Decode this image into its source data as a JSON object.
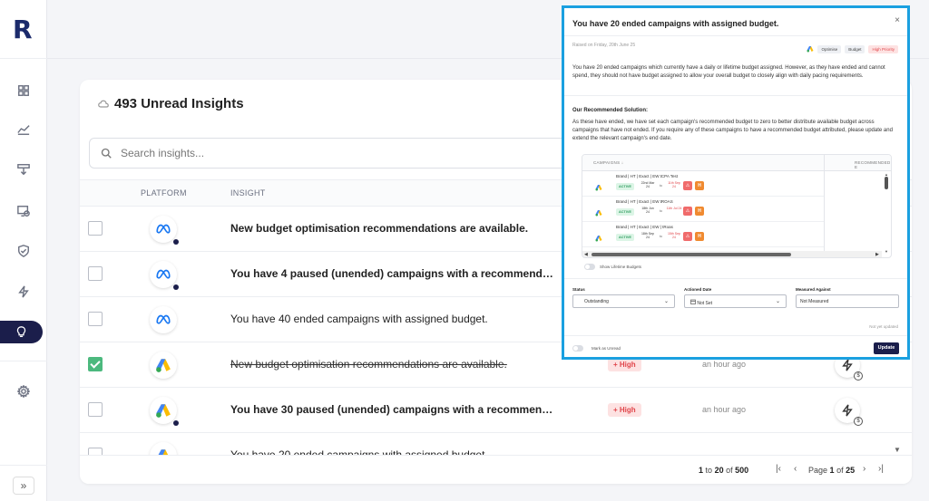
{
  "sidebar": {
    "logo": "R",
    "items": [
      {
        "name": "dashboard",
        "icon": "grid-icon"
      },
      {
        "name": "analytics",
        "icon": "chart-line-icon"
      },
      {
        "name": "budget",
        "icon": "download-table-icon"
      },
      {
        "name": "history",
        "icon": "monitor-clock-icon"
      },
      {
        "name": "security",
        "icon": "shield-icon"
      },
      {
        "name": "automation",
        "icon": "bolt-icon"
      },
      {
        "name": "insights",
        "icon": "lightbulb-icon",
        "active": true
      },
      {
        "name": "settings",
        "icon": "gear-icon"
      }
    ],
    "expand_label": "»"
  },
  "card": {
    "title": "493 Unread Insights",
    "search_placeholder": "Search insights...",
    "columns": {
      "platform": "PLATFORM",
      "insight": "INSIGHT"
    },
    "rows": [
      {
        "platform": "meta",
        "insight": "New budget optimisation recommendations are available.",
        "bold": true,
        "checked": false,
        "unread_dot": true
      },
      {
        "platform": "meta",
        "insight": "You have 4 paused (unended) campaigns with a recommended...",
        "bold": true,
        "checked": false,
        "unread_dot": true
      },
      {
        "platform": "meta",
        "insight": "You have 40 ended campaigns with assigned budget.",
        "bold": false,
        "checked": false,
        "unread_dot": false
      },
      {
        "platform": "google-ads",
        "insight": "New budget optimisation recommendations are available.",
        "bold": false,
        "checked": true,
        "strike": true,
        "unread_dot": false,
        "priority": "+ High",
        "time": "an hour ago"
      },
      {
        "platform": "google-ads",
        "insight": "You have 30 paused (unended) campaigns with a recommende...",
        "bold": true,
        "checked": false,
        "unread_dot": true,
        "priority": "+ High",
        "time": "an hour ago"
      },
      {
        "platform": "google-ads",
        "insight": "You have 20 ended campaigns with assigned budget.",
        "bold": false,
        "checked": false,
        "unread_dot": false,
        "priority": "",
        "time": ""
      }
    ],
    "pagination": {
      "range_start": "1",
      "range_to": "to",
      "range_end": "20",
      "of": "of",
      "total": "500",
      "page_label": "Page",
      "page": "1",
      "page_of": "of",
      "pages": "25"
    }
  },
  "modal": {
    "title": "You have 20 ended campaigns with assigned budget.",
    "raised_on": "Raised on Friday, 20th June 25",
    "tags": [
      "Optimise",
      "Budget",
      "High Priority"
    ],
    "description": "You have 20 ended campaigns which currently have a daily or lifetime budget assigned. However, as they have ended and cannot spend, they should not have budget assigned to allow your overall budget to closely align with daily pacing requirements.",
    "solution_title": "Our Recommended Solution:",
    "solution": "As these have ended, we have set each campaign's recommended budget to zero to better distribute available budget across campaigns that have not ended. If you require any of these campaigns to have a recommended budget attributed, please update and extend the relevant campaign's end date.",
    "table": {
      "col_campaigns": "CAMPAIGNS ↓",
      "col_recommended": "RECOMMENDED E",
      "rows": [
        {
          "name": "Brand | HT | Exact | EW tCPA Test",
          "status": "ACTIVE",
          "start": "22nd Mar 24",
          "to": "to",
          "end": "11th Sep 24",
          "badge": "H"
        },
        {
          "name": "Brand | HT | Exact | EW tROAS",
          "status": "ACTIVE",
          "start": "18th Jun 24",
          "to": "to",
          "end": "11th Jul 24",
          "badge": "H"
        },
        {
          "name": "Brand | HT | Exact | EW | tRoas",
          "status": "ACTIVE",
          "start": "18th Sep 24",
          "to": "to",
          "end": "15th Sep 24",
          "badge": "H"
        }
      ]
    },
    "show_lifetime_label": "Show Lifetime Budgets",
    "fields": {
      "status_label": "Status",
      "status_value": "Outstanding",
      "actioned_label": "Actioned Date",
      "actioned_value": "Not Set",
      "measured_label": "Measured Against",
      "measured_value": "Not Measured"
    },
    "not_updated": "Not yet updated",
    "mark_unread_label": "Mark as Unread",
    "update_button": "Update",
    "close": "×"
  },
  "colors": {
    "accent": "#1b1e4b",
    "modal_border": "#1aa0e0",
    "priority_bg": "#fde2e2",
    "priority_text": "#e0454a",
    "check_green": "#4cb97e"
  }
}
